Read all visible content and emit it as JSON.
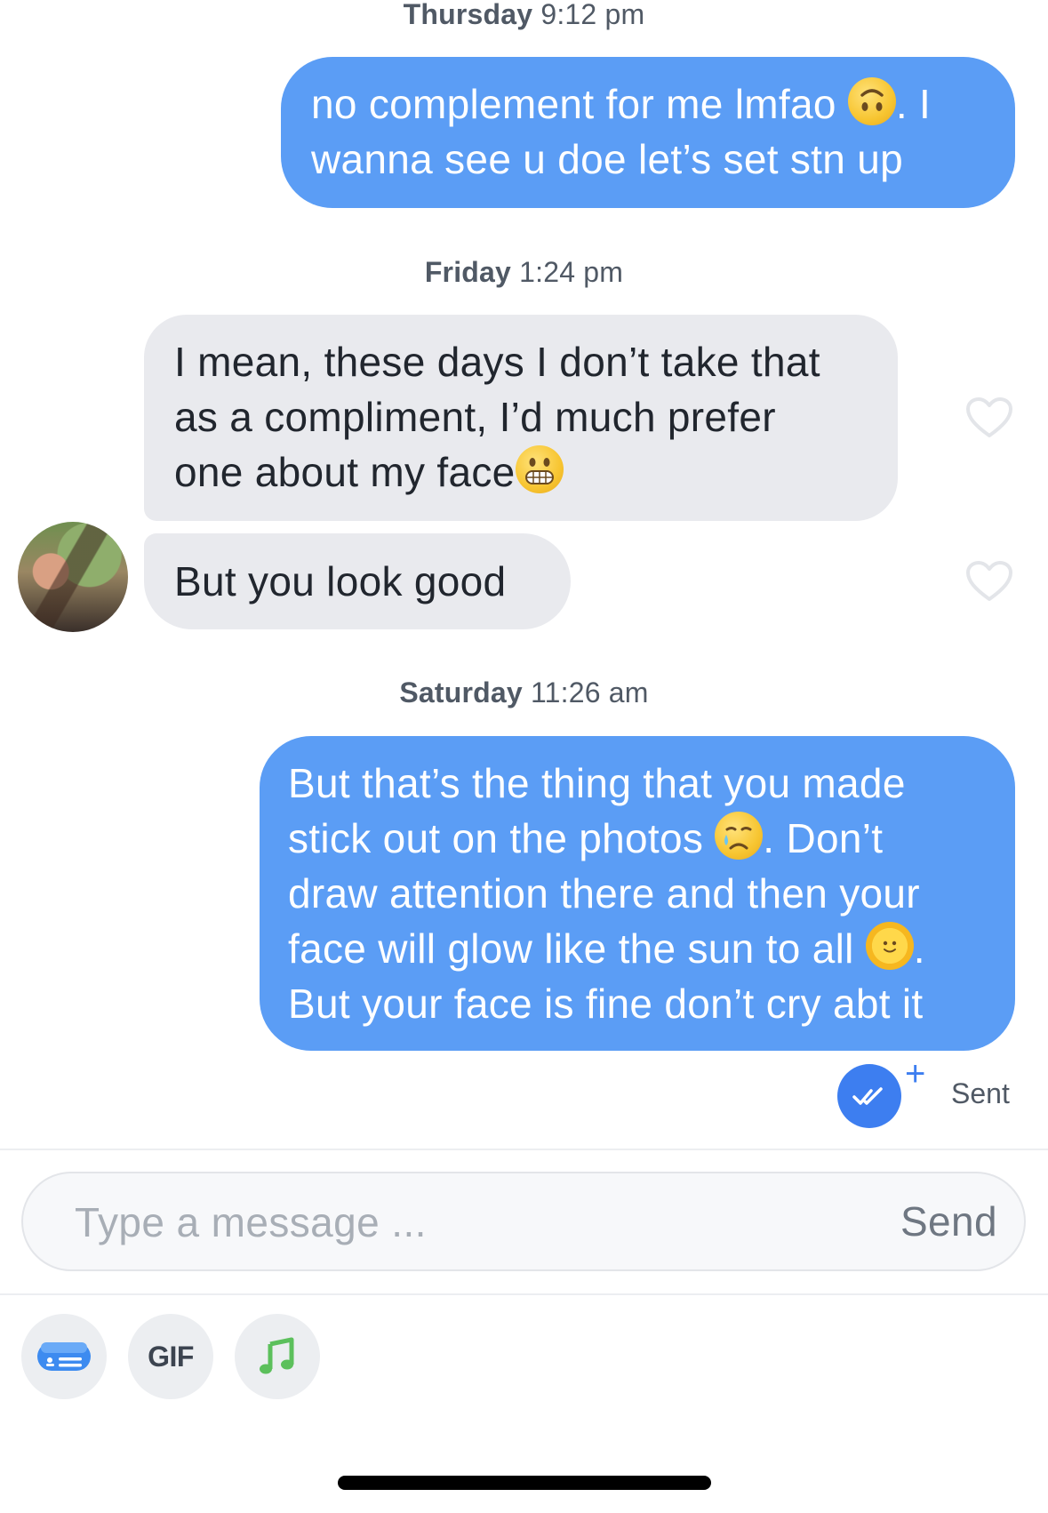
{
  "conversation": {
    "groups": [
      {
        "timestamp_day": "Thursday",
        "timestamp_time": "9:12 pm",
        "messages": [
          {
            "side": "sent",
            "lines": [
              "no complement for me lmfao",
              ". I",
              "wanna see u doe let’s set stn up"
            ],
            "emoji": "upside-down-face-emoji"
          }
        ]
      },
      {
        "timestamp_day": "Friday",
        "timestamp_time": "1:24 pm",
        "messages": [
          {
            "side": "received",
            "lines": [
              "I mean, these days I don’t take that",
              "as a compliment, I’d much prefer",
              "one about my face"
            ],
            "emoji": "grimacing-face-emoji"
          },
          {
            "side": "received",
            "lines": [
              "But you look good"
            ]
          }
        ]
      },
      {
        "timestamp_day": "Saturday",
        "timestamp_time": "11:26 am",
        "messages": [
          {
            "side": "sent",
            "lines": [
              "But that’s the thing that you made",
              "stick out on the photos",
              ". Don’t",
              "draw attention there and then your",
              "face will glow like the sun to all",
              ".",
              "But your face is fine don’t cry abt it"
            ],
            "emojis": [
              "crying-face-emoji",
              "sun-with-face-emoji"
            ]
          }
        ]
      }
    ],
    "status": "Sent"
  },
  "composer": {
    "placeholder": "Type a message ...",
    "send_label": "Send",
    "tools": [
      {
        "name": "id-card-icon"
      },
      {
        "name": "gif-button",
        "label": "GIF"
      },
      {
        "name": "music-note-icon"
      }
    ]
  },
  "colors": {
    "sent_bubble": "#5b9df5",
    "received_bubble": "#e9eaee",
    "status_blue": "#3d7ef0",
    "music_green": "#5cc05c"
  }
}
